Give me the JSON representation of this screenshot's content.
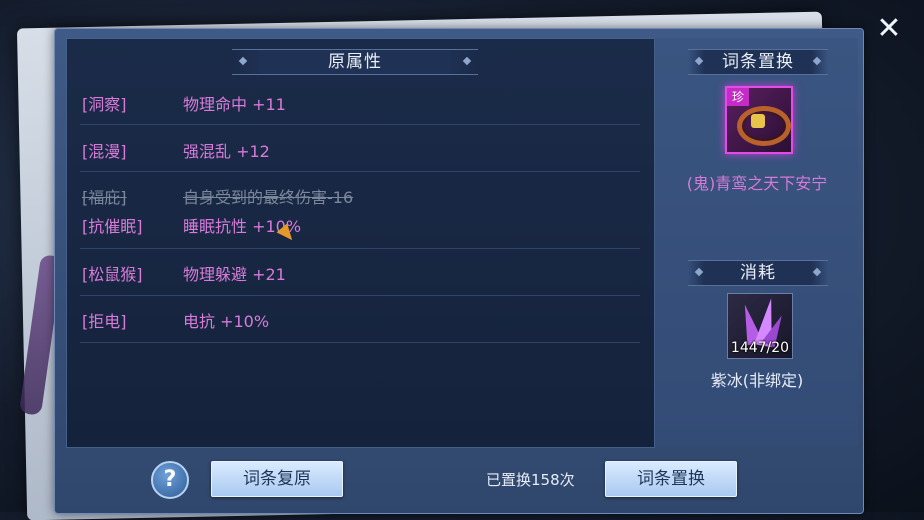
{
  "panel": {
    "header_title": "原属性",
    "attributes": [
      {
        "tag": "[洞察]",
        "value": "物理命中 +11"
      },
      {
        "tag": "[混漫]",
        "value": "强混乱 +12"
      },
      {
        "tag": "[福庇]",
        "value": "自身受到的最终伤害-16",
        "struck": true
      },
      {
        "tag": "[抗催眠]",
        "value": "睡眠抗性 +10%"
      },
      {
        "tag": "[松鼠猴]",
        "value": "物理躲避 +21"
      },
      {
        "tag": "[拒电]",
        "value": "电抗 +10%"
      }
    ]
  },
  "side": {
    "swap_header": "词条置换",
    "item_badge": "珍",
    "item_name": "(鬼)青鸾之天下安宁",
    "consume_header": "消耗",
    "material_count": "1447/20",
    "material_name": "紫冰(非绑定)"
  },
  "footer": {
    "help_label": "?",
    "restore_label": "词条复原",
    "swap_count_text": "已置换158次",
    "swap_label": "词条置换"
  },
  "close_label": "✕",
  "colors": {
    "attribute_pink": "#d77ad8",
    "struck_gray": "#7b879a",
    "rarity_magenta": "#e14be6"
  }
}
